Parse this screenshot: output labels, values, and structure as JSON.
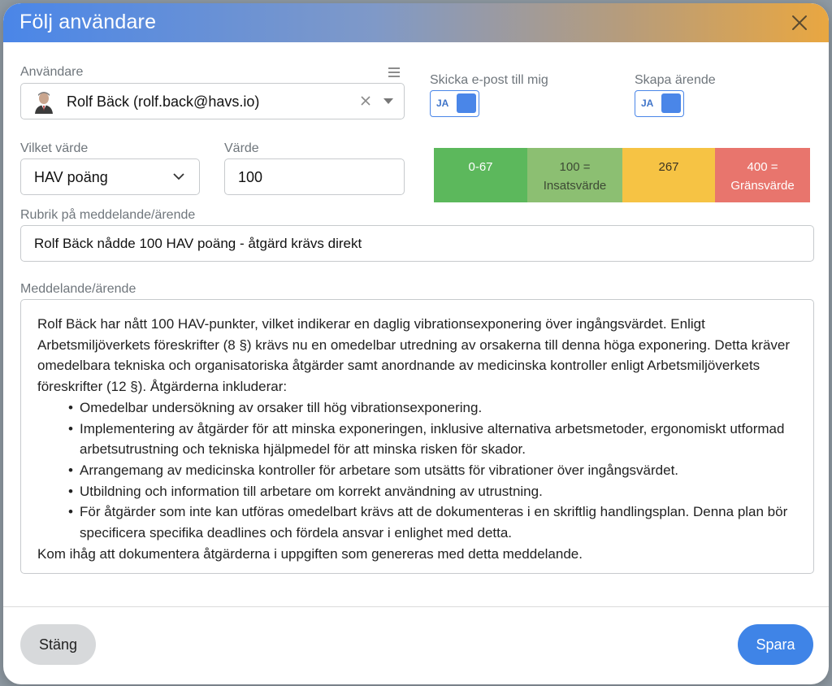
{
  "dialog": {
    "title": "Följ användare"
  },
  "user": {
    "label": "Användare",
    "value": "Rolf Bäck (rolf.back@havs.io)"
  },
  "email_toggle": {
    "label": "Skicka e-post till mig",
    "value": "JA"
  },
  "case_toggle": {
    "label": "Skapa ärende",
    "value": "JA"
  },
  "which_value": {
    "label": "Vilket värde",
    "value": "HAV poäng"
  },
  "value": {
    "label": "Värde",
    "value": "100"
  },
  "scale": [
    {
      "line1": "0-67",
      "line2": ""
    },
    {
      "line1": "100 =",
      "line2": "Insatsvärde"
    },
    {
      "line1": "267",
      "line2": ""
    },
    {
      "line1": "400 =",
      "line2": "Gränsvärde"
    }
  ],
  "subject": {
    "label": "Rubrik på meddelande/ärende",
    "value": "Rolf Bäck nådde 100 HAV poäng - åtgärd krävs direkt"
  },
  "message": {
    "label": "Meddelande/ärende",
    "intro": "Rolf Bäck har nått 100 HAV-punkter, vilket indikerar en daglig vibrationsexponering över ingångsvärdet. Enligt Arbetsmiljöverkets föreskrifter (8 §) krävs nu en omedelbar utredning av orsakerna till denna höga exponering. Detta kräver omedelbara tekniska och organisatoriska åtgärder samt anordnande av medicinska kontroller enligt Arbetsmiljöverkets föreskrifter (12 §). Åtgärderna inkluderar:",
    "items": [
      "Omedelbar undersökning av orsaker till hög vibrationsexponering.",
      "Implementering av åtgärder för att minska exponeringen, inklusive alternativa arbetsmetoder, ergonomiskt utformad arbetsutrustning och tekniska hjälpmedel för att minska risken för skador.",
      "Arrangemang av medicinska kontroller för arbetare som utsätts för vibrationer över ingångsvärdet.",
      "Utbildning och information till arbetare om korrekt användning av utrustning.",
      "För åtgärder som inte kan utföras omedelbart krävs att de dokumenteras i en skriftlig handlingsplan. Denna plan bör specificera specifika deadlines och fördela ansvar i enlighet med detta."
    ],
    "outro": "Kom ihåg att dokumentera åtgärderna i uppgiften som genereras med detta meddelande."
  },
  "footer": {
    "close_label": "Stäng",
    "save_label": "Spara"
  },
  "icons": {
    "close": "close-icon",
    "clear": "clear-icon",
    "caret": "caret-down-icon",
    "list": "list-icon",
    "chevron": "chevron-down-icon"
  },
  "colors": {
    "accent": "#4a86e8",
    "scale_green": "#5cb85c",
    "scale_lightgreen": "#8cbf72",
    "scale_yellow": "#f6c344",
    "scale_red": "#e8756d"
  }
}
